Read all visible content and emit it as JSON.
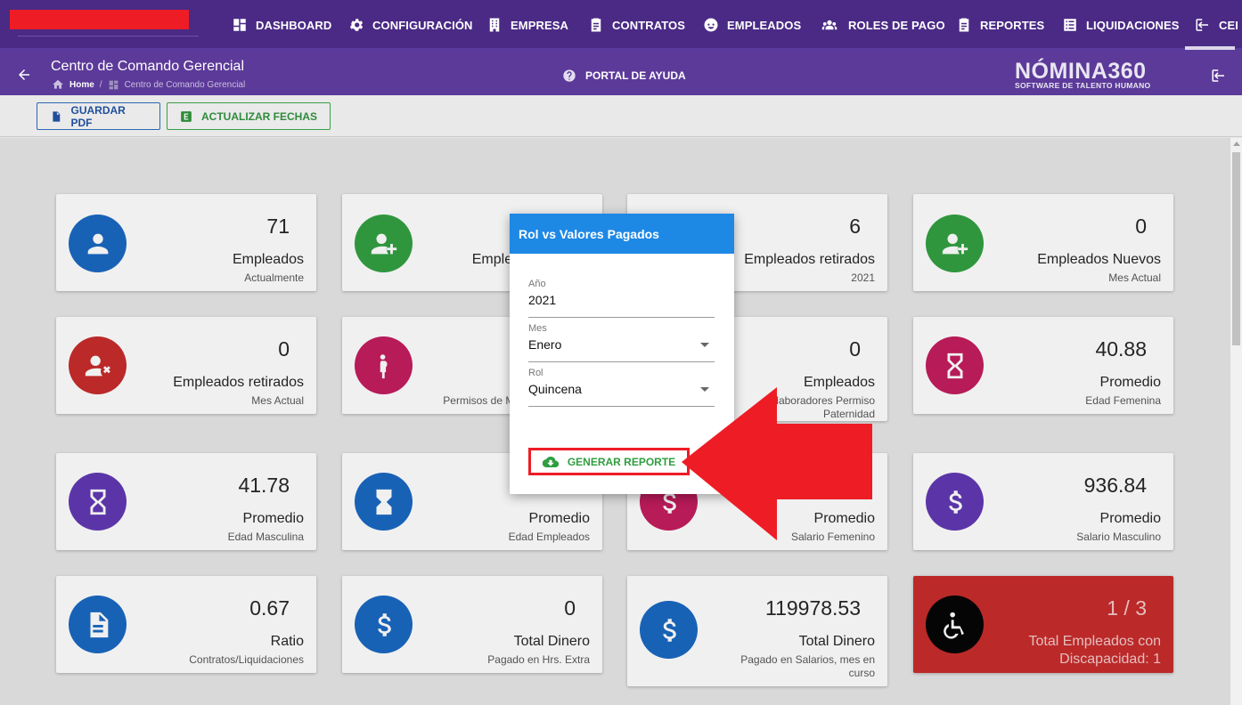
{
  "nav": {
    "items": [
      {
        "label": "DASHBOARD",
        "icon": "dashboard-icon"
      },
      {
        "label": "CONFIGURACIÓN",
        "icon": "gear-icon"
      },
      {
        "label": "EMPRESA",
        "icon": "building-icon"
      },
      {
        "label": "CONTRATOS",
        "icon": "clipboard-icon"
      },
      {
        "label": "EMPLEADOS",
        "icon": "face-icon"
      },
      {
        "label": "ROLES DE PAGO",
        "icon": "group-icon"
      },
      {
        "label": "REPORTES",
        "icon": "clipboard-icon"
      },
      {
        "label": "LIQUIDACIONES",
        "icon": "list-icon"
      },
      {
        "label": "CEI",
        "icon": "logout-icon"
      }
    ]
  },
  "header": {
    "title": "Centro de Comando Gerencial",
    "breadcrumb_home": "Home",
    "breadcrumb_current": "Centro de Comando Gerencial",
    "help": "PORTAL DE AYUDA",
    "logo_main": "NÓMINA360",
    "logo_sub": "SOFTWARE DE TALENTO HUMANO"
  },
  "toolbar": {
    "pdf": "GUARDAR PDF",
    "excel": "ACTUALIZAR FECHAS"
  },
  "cards": [
    {
      "value": "71",
      "label": "Empleados",
      "sub": "Actualmente",
      "color": "#1565c0",
      "icon": "person-icon"
    },
    {
      "value": "",
      "label": "Emplea",
      "sub": "",
      "color": "#2e9e3e",
      "icon": "person-add-icon"
    },
    {
      "value": "6",
      "label": "Empleados retirados",
      "sub": "2021",
      "color": "#2e9e3e",
      "icon": "person-add-icon"
    },
    {
      "value": "0",
      "label": "Empleados Nuevos",
      "sub": "Mes Actual",
      "color": "#2e9e3e",
      "icon": "person-add-icon"
    },
    {
      "value": "0",
      "label": "Empleados retirados",
      "sub": "Mes Actual",
      "color": "#c62828",
      "icon": "person-remove-icon"
    },
    {
      "value": "",
      "label": "",
      "sub": "Permisos de Ma",
      "color": "#c2185b",
      "icon": "pregnant-icon"
    },
    {
      "value": "0",
      "label": "Empleados",
      "sub": "Colaboradores Permiso Paternidad",
      "color": "#c2185b",
      "icon": "person-icon"
    },
    {
      "value": "40.88",
      "label": "Promedio",
      "sub": "Edad Femenina",
      "color": "#c2185b",
      "icon": "hourglass-icon"
    },
    {
      "value": "41.78",
      "label": "Promedio",
      "sub": "Edad Masculina",
      "color": "#5e35b1",
      "icon": "hourglass-icon"
    },
    {
      "value": "",
      "label": "Promedio",
      "sub": "Edad Empleados",
      "color": "#1565c0",
      "icon": "hourglass-icon"
    },
    {
      "value": "",
      "label": "Promedio",
      "sub": "Salario Femenino",
      "color": "#c2185b",
      "icon": "dollar-icon"
    },
    {
      "value": "936.84",
      "label": "Promedio",
      "sub": "Salario Masculino",
      "color": "#5e35b1",
      "icon": "dollar-icon"
    },
    {
      "value": "0.67",
      "label": "Ratio",
      "sub": "Contratos/Liquidaciones",
      "color": "#1565c0",
      "icon": "document-icon"
    },
    {
      "value": "0",
      "label": "Total Dinero",
      "sub": "Pagado en Hrs. Extra",
      "color": "#1565c0",
      "icon": "dollar-icon"
    },
    {
      "value": "119978.53",
      "label": "Total Dinero",
      "sub": "Pagado en Salarios, mes en curso",
      "color": "#1565c0",
      "icon": "dollar-icon"
    },
    {
      "value": "1 / 3",
      "label": "Total Empleados con Discapacidad: 1",
      "sub": "",
      "color": "#000000",
      "icon": "wheelchair-icon"
    }
  ],
  "modal": {
    "title": "Rol vs Valores Pagados",
    "year_label": "Año",
    "year_value": "2021",
    "month_label": "Mes",
    "month_value": "Enero",
    "rol_label": "Rol",
    "rol_value": "Quincena",
    "generate": "GENERAR REPORTE"
  }
}
